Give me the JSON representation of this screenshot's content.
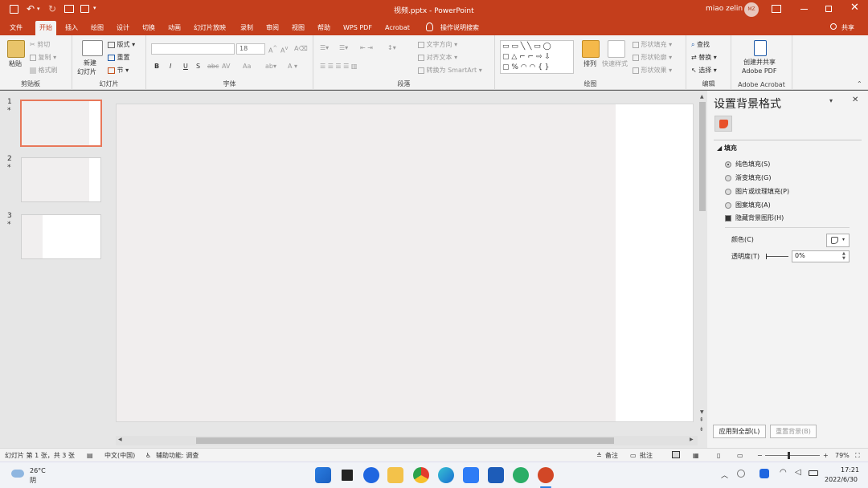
{
  "titlebar": {
    "qat_labels": [
      "ﾂｷ"
    ],
    "doc_title": "视频.pptx - PowerPoint",
    "user_name": "miao zelin",
    "user_initials": "MZ"
  },
  "tabs": [
    "文件",
    "开始",
    "插入",
    "绘图",
    "设计",
    "切换",
    "动画",
    "幻灯片放映",
    "录制",
    "审阅",
    "视图",
    "帮助",
    "WPS PDF",
    "Acrobat"
  ],
  "active_tab": "开始",
  "search_label": "操作说明搜索",
  "share_label": "共享",
  "ribbon": {
    "clipboard": {
      "paste": "粘贴",
      "cut": "剪切",
      "copy": "复制",
      "format_painter": "格式刷",
      "label": "剪贴板"
    },
    "slides": {
      "new_slide": "新建",
      "new_slide2": "幻灯片",
      "layout": "版式",
      "reset": "重置",
      "section": "节",
      "label": "幻灯片"
    },
    "font": {
      "size": "18",
      "bold": "B",
      "italic": "I",
      "underline": "U",
      "strike": "S",
      "shadow": "abc",
      "spacing": "AV",
      "case": "Aa",
      "label": "字体"
    },
    "paragraph": {
      "text_direction": "文字方向",
      "align_text": "对齐文本",
      "smartart": "转换为 SmartArt",
      "label": "段落"
    },
    "drawing": {
      "arrange": "排列",
      "quick_styles": "快速样式",
      "shape_fill": "形状填充",
      "shape_outline": "形状轮廓",
      "shape_effects": "形状效果",
      "label": "绘图"
    },
    "editing": {
      "find": "查找",
      "replace": "替换",
      "select": "选择",
      "label": "编辑"
    },
    "acrobat": {
      "create_share": "创建并共享",
      "adobe_pdf": "Adobe PDF",
      "label": "Adobe Acrobat"
    }
  },
  "slides": [
    {
      "num": "1",
      "star": "*"
    },
    {
      "num": "2",
      "star": "*"
    },
    {
      "num": "3",
      "star": "*"
    }
  ],
  "pane": {
    "title": "设置背景格式",
    "section_fill": "填充",
    "options": [
      "纯色填充(S)",
      "渐变填充(G)",
      "图片或纹理填充(P)",
      "图案填充(A)"
    ],
    "selected_option": 0,
    "hide_bg": "隐藏背景图形(H)",
    "color_label": "颜色(C)",
    "transparency_label": "透明度(T)",
    "transparency_value": "0%",
    "apply_all": "应用到全部(L)",
    "reset_bg": "重置背景(B)"
  },
  "status": {
    "slide_info": "幻灯片 第 1 张，共 3 张",
    "language": "中文(中国)",
    "accessibility": "辅助功能: 调查",
    "notes": "备注",
    "comments": "批注",
    "zoom": "79%"
  },
  "taskbar": {
    "weather_temp": "26°C",
    "weather_desc": "阴",
    "time": "17:21",
    "date": "2022/6/30"
  },
  "colors": {
    "accent": "#c43e1c",
    "slide_bg": "#f1eeee"
  }
}
